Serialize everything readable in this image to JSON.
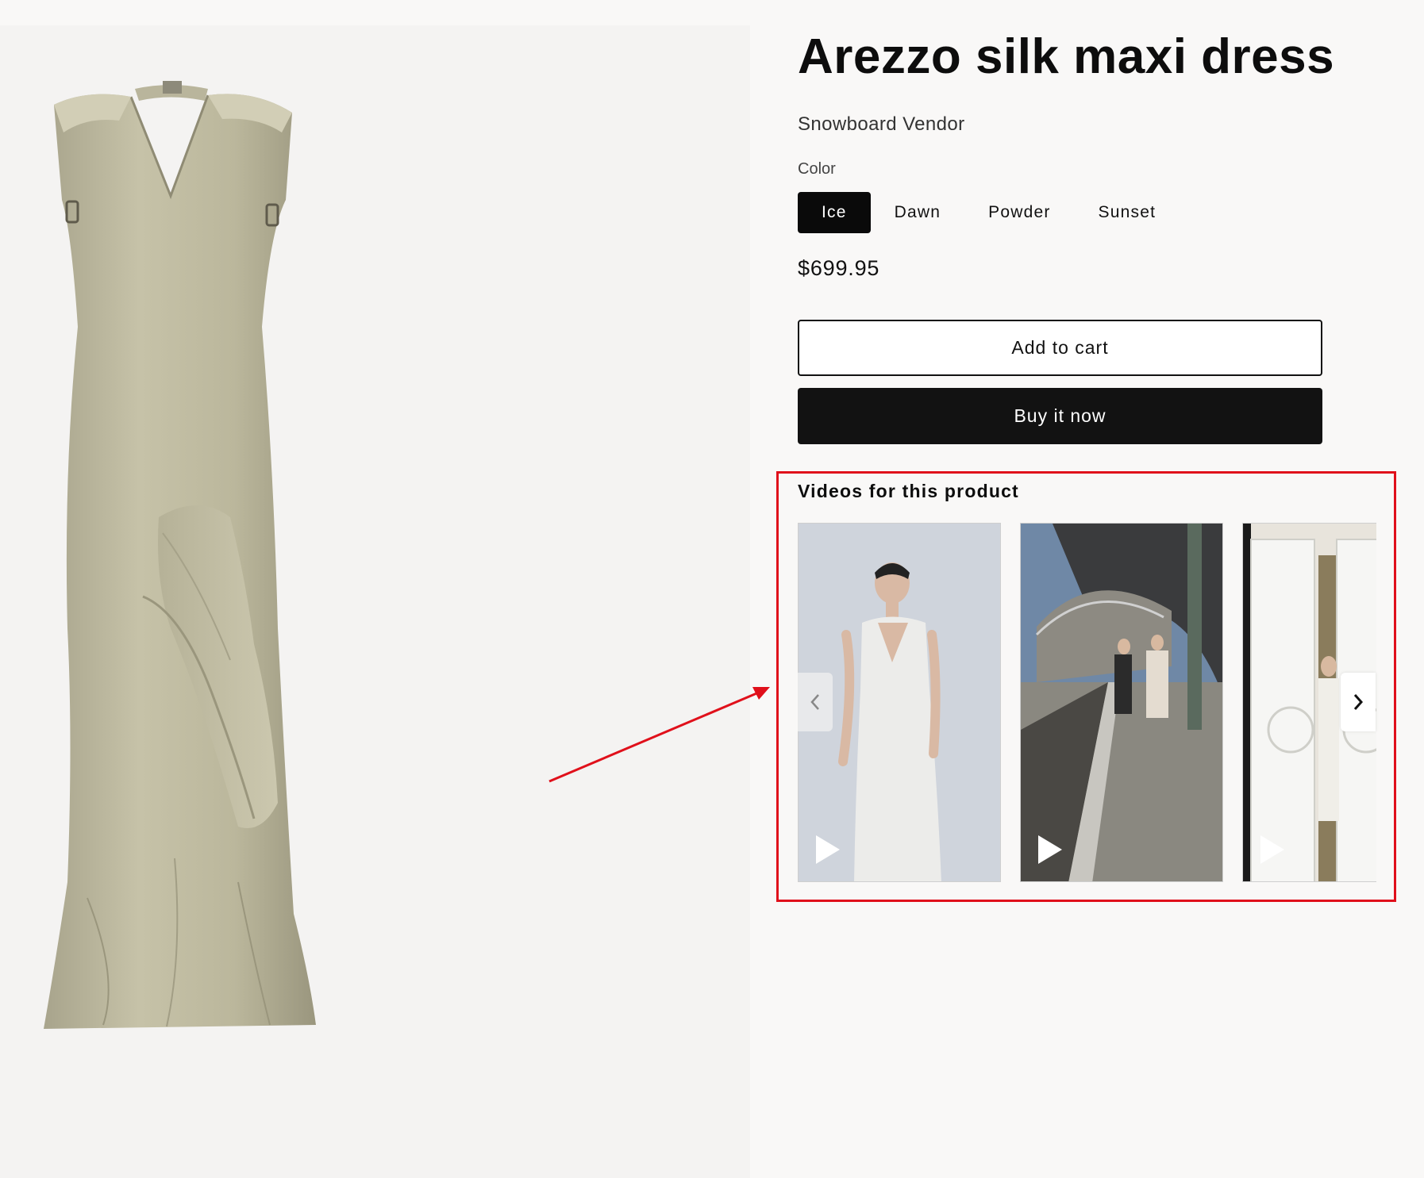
{
  "product": {
    "title": "Arezzo silk maxi dress",
    "vendor": "Snowboard Vendor",
    "color_label": "Color",
    "colors": [
      "Ice",
      "Dawn",
      "Powder",
      "Sunset"
    ],
    "selected_color": "Ice",
    "price": "$699.95"
  },
  "buttons": {
    "add_to_cart": "Add to cart",
    "buy_now": "Buy it now"
  },
  "videos": {
    "title": "Videos for this product",
    "items": [
      {
        "icon": "play-icon"
      },
      {
        "icon": "play-icon"
      },
      {
        "icon": "play-icon"
      }
    ]
  },
  "annotation": {
    "highlight_color": "#e0101b"
  },
  "icons": {
    "prev": "chevron-left-icon",
    "next": "chevron-right-icon",
    "play": "play-icon"
  }
}
